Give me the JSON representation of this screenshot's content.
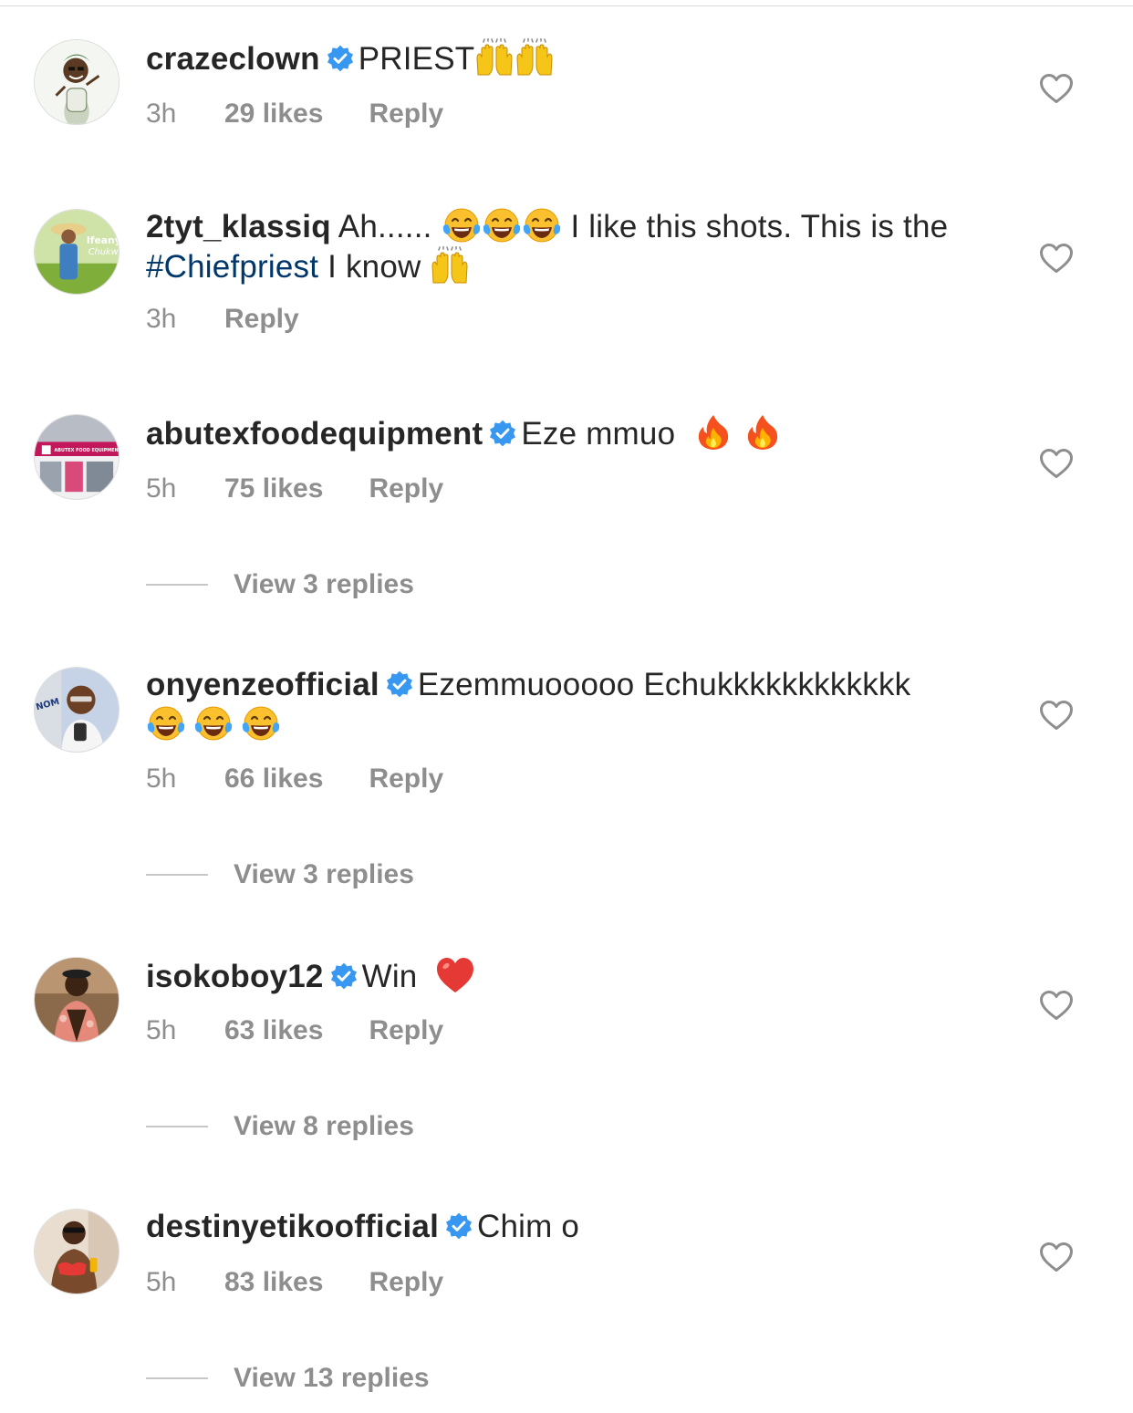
{
  "comments": [
    {
      "username": "crazeclown",
      "verified": true,
      "text": "PRIEST",
      "emojis": [
        "raising-hands",
        "raising-hands"
      ],
      "time": "3h",
      "likes": "29 likes",
      "reply": "Reply"
    },
    {
      "username": "2tyt_klassiq",
      "verified": false,
      "text_part1": "Ah......",
      "text_part2": "I like this shots. This is the",
      "hashtag": "#Chiefpriest",
      "text_part3": "I know",
      "emojis": [
        "tears-of-joy",
        "tears-of-joy",
        "tears-of-joy",
        "raising-hands"
      ],
      "time": "3h",
      "reply": "Reply"
    },
    {
      "username": "abutexfoodequipment",
      "verified": true,
      "text": "Eze mmuo",
      "emojis": [
        "fire",
        "fire"
      ],
      "time": "5h",
      "likes": "75 likes",
      "reply": "Reply",
      "view_replies": "View 3 replies"
    },
    {
      "username": "onyenzeofficial",
      "verified": true,
      "text": "Ezemmuooooo Echukkkkkkkkkkkk",
      "emojis": [
        "tears-of-joy",
        "tears-of-joy",
        "tears-of-joy"
      ],
      "time": "5h",
      "likes": "66 likes",
      "reply": "Reply",
      "view_replies": "View 3 replies"
    },
    {
      "username": "isokoboy12",
      "verified": true,
      "text": "Win",
      "emojis": [
        "red-heart"
      ],
      "time": "5h",
      "likes": "63 likes",
      "reply": "Reply",
      "view_replies": "View 8 replies"
    },
    {
      "username": "destinyetikoofficial",
      "verified": true,
      "text": "Chim o",
      "emojis": [],
      "time": "5h",
      "likes": "83 likes",
      "reply": "Reply",
      "view_replies": "View 13 replies"
    }
  ],
  "colors": {
    "text": "#262626",
    "meta": "#8e8e8e",
    "verified": "#3897f0",
    "hashtag": "#00376b"
  }
}
